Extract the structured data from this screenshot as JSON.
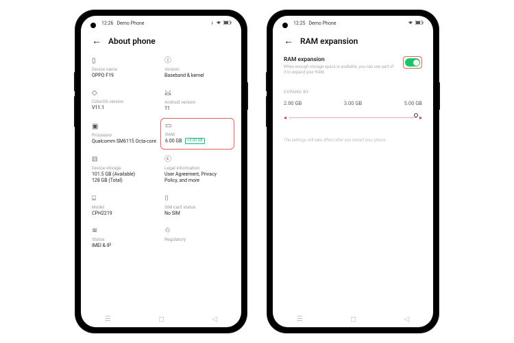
{
  "left": {
    "status": {
      "time": "12:26",
      "label": "Demo Phone"
    },
    "header": {
      "title": "About phone"
    },
    "cells": {
      "device_name": {
        "label": "Device name",
        "value": "OPPO F19"
      },
      "version": {
        "label": "Version",
        "value": "Baseband & kernel"
      },
      "coloros": {
        "label": "ColorOS version",
        "value": "V11.1"
      },
      "android": {
        "label": "Android version",
        "value": "11"
      },
      "processor": {
        "label": "Processor",
        "value": "Qualcomm SM6115 Octa-core"
      },
      "ram": {
        "label": "RAM",
        "value": "6.00 GB",
        "badge": "+5.00 GB"
      },
      "storage": {
        "label": "Device storage",
        "value": "101.5 GB (Available)\n128 GB (Total)"
      },
      "legal": {
        "label": "Legal information",
        "value": "User Agreement, Privacy Policy, and more"
      },
      "model": {
        "label": "Model",
        "value": "CPH2219"
      },
      "sim": {
        "label": "SIM card status",
        "value": "No SIM"
      },
      "status": {
        "label": "Status",
        "value": "IMEI & IP"
      },
      "regulatory": {
        "label": "Regulatory",
        "value": ""
      }
    }
  },
  "right": {
    "status": {
      "time": "12:25",
      "label": "Demo Phone"
    },
    "header": {
      "title": "RAM expansion"
    },
    "main": {
      "title": "RAM expansion",
      "desc": "When enough storage space is available, you can use part of it to expand your RAM."
    },
    "expand": {
      "label": "EXPAND BY",
      "opts": [
        "2.00 GB",
        "3.00 GB",
        "5.00 GB"
      ]
    },
    "note": "The settings will take effect after you restart your phone."
  }
}
